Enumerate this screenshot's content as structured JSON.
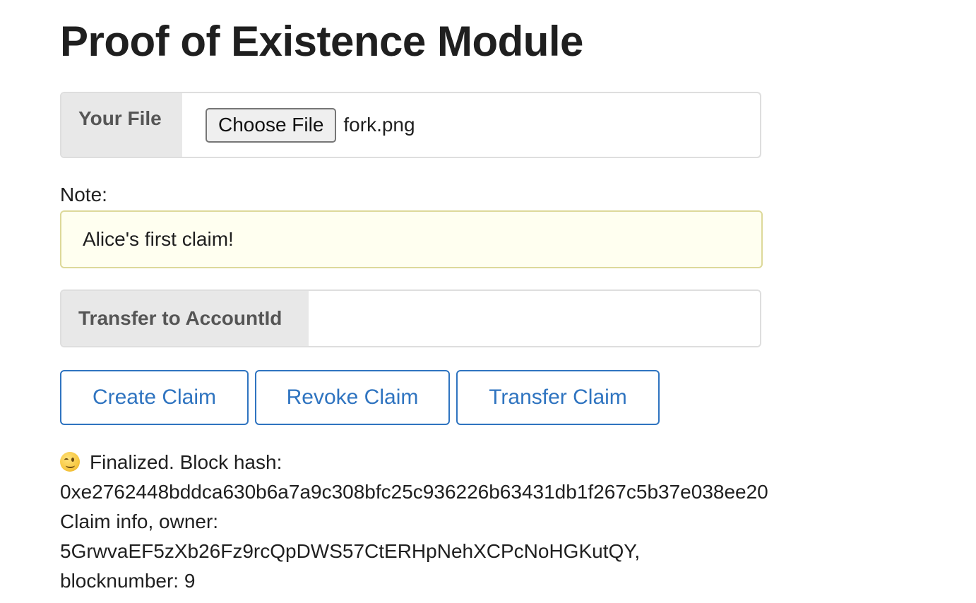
{
  "page": {
    "title": "Proof of Existence Module"
  },
  "file_input": {
    "label": "Your File",
    "button_label": "Choose File",
    "file_name": "fork.png"
  },
  "note": {
    "label": "Note:",
    "value": "Alice's first claim!"
  },
  "transfer": {
    "label": "Transfer to AccountId",
    "value": ""
  },
  "actions": {
    "create_label": "Create Claim",
    "revoke_label": "Revoke Claim",
    "transfer_label": "Transfer Claim"
  },
  "status": {
    "icon": "winking-face-icon",
    "line1": "Finalized. Block hash:",
    "line2": "0xe2762448bddca630b6a7a9c308bfc25c936226b63431db1f267c5b37e038ee20",
    "line3": "Claim info, owner:",
    "line4": "5GrwvaEF5zXb26Fz9rcQpDWS57CtERHpNehXCPcNoHGKutQY,",
    "line5": "blocknumber: 9"
  },
  "colors": {
    "accent": "#2f74c0",
    "label_bg": "#e8e8e8",
    "note_bg": "#fffff0",
    "note_border": "#ddd99a"
  }
}
